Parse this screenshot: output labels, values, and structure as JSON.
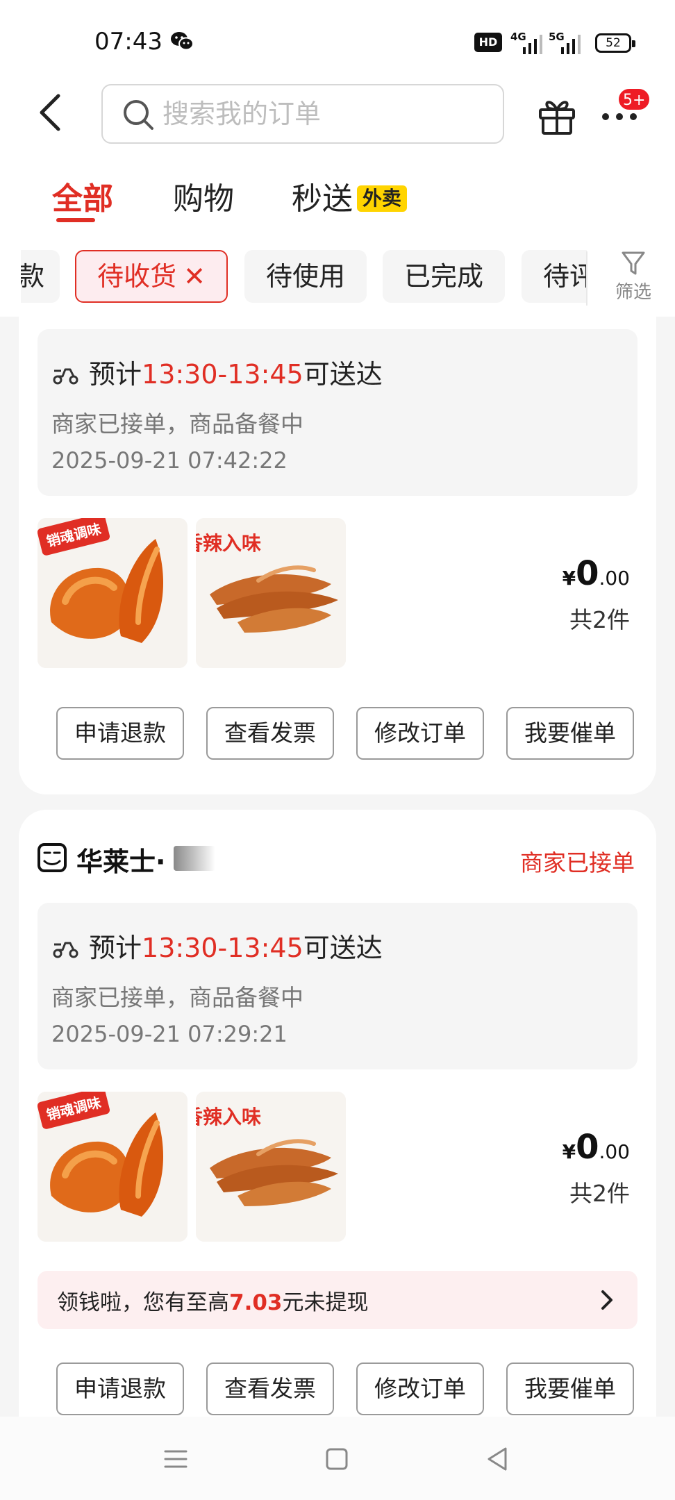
{
  "status_bar": {
    "time": "07:43",
    "network_hd": "HD",
    "signal1": "4G",
    "signal2": "5G",
    "battery": "52"
  },
  "header": {
    "search_placeholder": "搜索我的订单",
    "badge": "5+"
  },
  "main_tabs": [
    {
      "label": "全部",
      "active": true
    },
    {
      "label": "购物",
      "active": false
    },
    {
      "label": "秒送",
      "badge": "外卖",
      "active": false
    }
  ],
  "filter_chips": [
    {
      "label": "款"
    },
    {
      "label": "待收货",
      "close": "✕",
      "active": true
    },
    {
      "label": "待使用"
    },
    {
      "label": "已完成"
    },
    {
      "label": "待评价"
    }
  ],
  "filter_button": {
    "label": "筛选"
  },
  "orders": [
    {
      "eta_prefix": "预计",
      "eta_time": "13:30-13:45",
      "eta_suffix": "可送达",
      "status_text": "商家已接单，商品备餐中",
      "datetime": "2025-09-21 07:42:22",
      "thumb1_tag": "销魂调味",
      "thumb2_tag": "香辣入味",
      "price_symbol": "¥",
      "price_int": "0",
      "price_dec": ".00",
      "count": "共2件",
      "buttons": [
        "申请退款",
        "查看发票",
        "修改订单",
        "我要催单"
      ]
    },
    {
      "store_name": "华莱士·",
      "store_status": "商家已接单",
      "eta_prefix": "预计",
      "eta_time": "13:30-13:45",
      "eta_suffix": "可送达",
      "status_text": "商家已接单，商品备餐中",
      "datetime": "2025-09-21 07:29:21",
      "thumb1_tag": "销魂调味",
      "thumb2_tag": "香辣入味",
      "price_symbol": "¥",
      "price_int": "0",
      "price_dec": ".00",
      "count": "共2件",
      "promo_prefix": "领钱啦，您有至高",
      "promo_amount": "7.03",
      "promo_suffix": "元未提现",
      "buttons": [
        "申请退款",
        "查看发票",
        "修改订单",
        "我要催单"
      ]
    }
  ],
  "colors": {
    "accent": "#e02e24",
    "waimai_badge": "#ffd400",
    "promo_bg": "#fdeff0"
  }
}
